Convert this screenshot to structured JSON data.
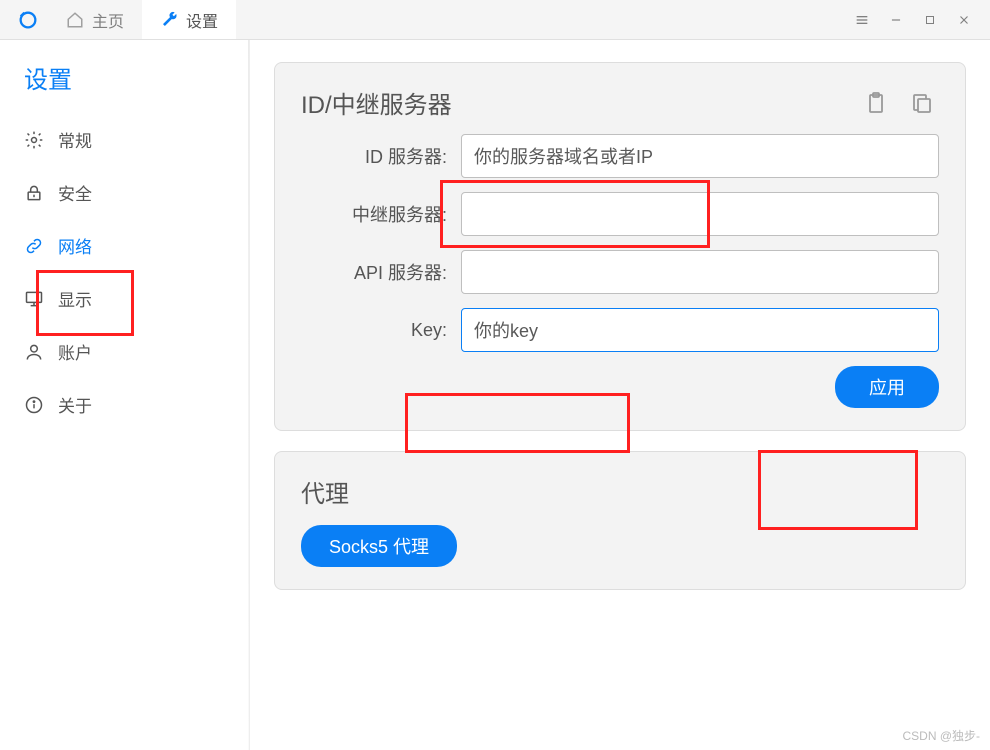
{
  "titlebar": {
    "tabs": [
      {
        "label": "主页",
        "active": false
      },
      {
        "label": "设置",
        "active": true
      }
    ]
  },
  "sidebar": {
    "title": "设置",
    "items": [
      {
        "label": "常规",
        "icon": "gear-icon"
      },
      {
        "label": "安全",
        "icon": "lock-icon"
      },
      {
        "label": "网络",
        "icon": "link-icon"
      },
      {
        "label": "显示",
        "icon": "monitor-icon"
      },
      {
        "label": "账户",
        "icon": "user-icon"
      },
      {
        "label": "关于",
        "icon": "info-icon"
      }
    ],
    "active_index": 2
  },
  "id_relay_card": {
    "title": "ID/中继服务器",
    "fields": {
      "id_server": {
        "label": "ID 服务器:",
        "value": "你的服务器域名或者IP"
      },
      "relay_server": {
        "label": "中继服务器:",
        "value": ""
      },
      "api_server": {
        "label": "API 服务器:",
        "value": ""
      },
      "key": {
        "label": "Key:",
        "value": "你的key"
      }
    },
    "apply_label": "应用"
  },
  "proxy_card": {
    "title": "代理",
    "socks5_label": "Socks5 代理"
  },
  "watermark": "CSDN @独步-"
}
